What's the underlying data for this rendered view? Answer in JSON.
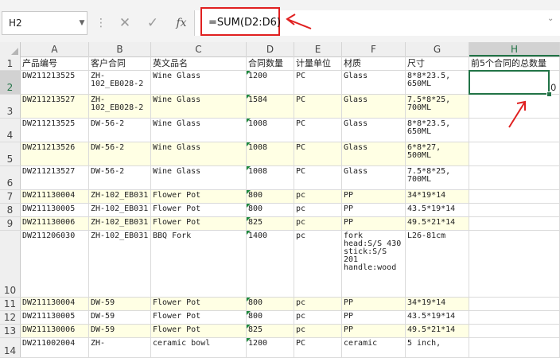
{
  "name_box": {
    "value": "H2"
  },
  "formula_bar": {
    "cancel_icon": "close-icon",
    "enter_icon": "check-icon",
    "fx_label": "fx",
    "formula": "=SUM(D2:D6)"
  },
  "columns": [
    "A",
    "B",
    "C",
    "D",
    "E",
    "F",
    "G",
    "H"
  ],
  "header_row": {
    "number": "1",
    "cells": [
      "产品编号",
      "客户合同",
      "英文品名",
      "合同数量",
      "计量单位",
      "材质",
      "尺寸",
      "前5个合同的总数量"
    ]
  },
  "rows": [
    {
      "number": "2",
      "highlight": false,
      "cells": [
        "DW211213525",
        "ZH-\n102_EB028-2",
        "Wine Glass",
        "1200",
        "PC",
        "Glass",
        "8*8*23.5,\n650ML",
        "0"
      ]
    },
    {
      "number": "3",
      "highlight": true,
      "cells": [
        "DW211213527",
        "ZH-\n102_EB028-2",
        "Wine Glass",
        "1584",
        "PC",
        "Glass",
        "7.5*8*25,\n700ML",
        ""
      ]
    },
    {
      "number": "4",
      "highlight": false,
      "cells": [
        "DW211213525",
        "DW-56-2",
        "Wine Glass",
        "1008",
        "PC",
        "Glass",
        "8*8*23.5,\n650ML",
        ""
      ]
    },
    {
      "number": "5",
      "highlight": true,
      "cells": [
        "DW211213526",
        "DW-56-2",
        "Wine Glass",
        "1008",
        "PC",
        "Glass",
        "6*8*27,\n500ML",
        ""
      ]
    },
    {
      "number": "6",
      "highlight": false,
      "cells": [
        "DW211213527",
        "DW-56-2",
        "Wine Glass",
        "1008",
        "PC",
        "Glass",
        "7.5*8*25,\n700ML",
        ""
      ]
    },
    {
      "number": "7",
      "highlight": true,
      "cells": [
        "DW211130004",
        "ZH-102_EB031",
        "Flower Pot",
        "800",
        "pc",
        "PP",
        "34*19*14",
        ""
      ]
    },
    {
      "number": "8",
      "highlight": false,
      "cells": [
        "DW211130005",
        "ZH-102_EB031",
        "Flower Pot",
        "800",
        "pc",
        "PP",
        "43.5*19*14",
        ""
      ]
    },
    {
      "number": "9",
      "highlight": true,
      "cells": [
        "DW211130006",
        "ZH-102_EB031",
        "Flower Pot",
        "825",
        "pc",
        "PP",
        "49.5*21*14",
        ""
      ]
    },
    {
      "number": "10",
      "highlight": false,
      "cells": [
        "DW211206030",
        "ZH-102_EB031",
        "BBQ Fork",
        "1400",
        "pc",
        "fork\nhead:S/S 430\nstick:S/S\n201\nhandle:wood",
        "L26-81cm",
        ""
      ]
    },
    {
      "number": "11",
      "highlight": true,
      "cells": [
        "DW211130004",
        "DW-59",
        "Flower Pot",
        "800",
        "pc",
        "PP",
        "34*19*14",
        ""
      ]
    },
    {
      "number": "12",
      "highlight": false,
      "cells": [
        "DW211130005",
        "DW-59",
        "Flower Pot",
        "800",
        "pc",
        "PP",
        "43.5*19*14",
        ""
      ]
    },
    {
      "number": "13",
      "highlight": true,
      "cells": [
        "DW211130006",
        "DW-59",
        "Flower Pot",
        "825",
        "pc",
        "PP",
        "49.5*21*14",
        ""
      ]
    },
    {
      "number": "14",
      "highlight": false,
      "cells": [
        "DW211002004",
        "ZH-",
        "ceramic bowl",
        "1200",
        "PC",
        "ceramic",
        "5 inch,",
        ""
      ]
    }
  ],
  "selected_cell": "H2",
  "colors": {
    "accent": "#217346",
    "annotation": "#e02020",
    "row_highlight": "#ffffe4"
  }
}
